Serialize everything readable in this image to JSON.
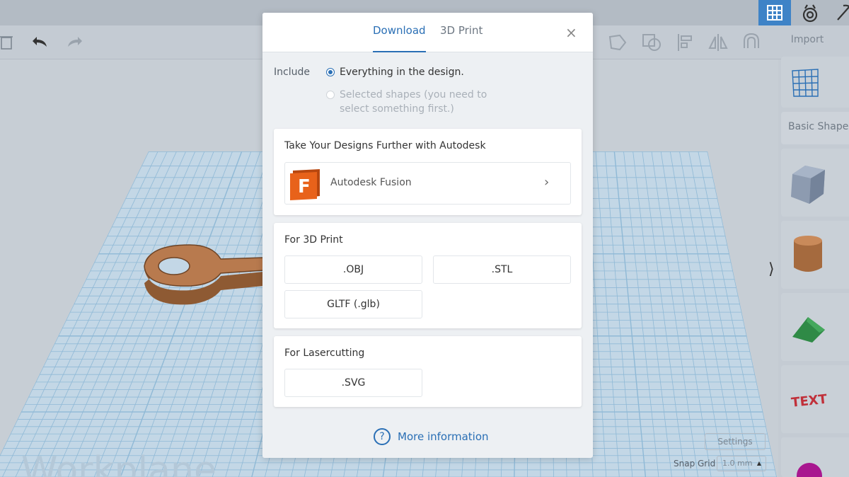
{
  "toolbar": {
    "undo_icon": "undo-arrow-icon",
    "redo_icon": "redo-arrow-icon"
  },
  "sidebar": {
    "import_label": "Import",
    "basic_shapes_label": "Basic Shapes",
    "settings_label": "Settings",
    "snap_grid_label": "Snap Grid",
    "snap_grid_value": "1.0 mm"
  },
  "workplane": {
    "label": "Workplane"
  },
  "modal": {
    "tabs": [
      {
        "label": "Download",
        "active": true
      },
      {
        "label": "3D Print",
        "active": false
      }
    ],
    "close_symbol": "×",
    "include_label": "Include",
    "options": [
      {
        "label": "Everything in the design.",
        "checked": true,
        "disabled": false
      },
      {
        "label": "Selected shapes (you need to select something first.)",
        "checked": false,
        "disabled": true
      }
    ],
    "autodesk_section": {
      "title": "Take Your Designs Further with Autodesk",
      "fusion_label": "Autodesk Fusion",
      "fusion_logo_letter": "F"
    },
    "print_section": {
      "title": "For 3D Print",
      "buttons": [
        ".OBJ",
        ".STL",
        "GLTF (.glb)"
      ]
    },
    "laser_section": {
      "title": "For Lasercutting",
      "buttons": [
        ".SVG"
      ]
    },
    "more_info": {
      "icon_glyph": "?",
      "label": "More information"
    }
  },
  "colors": {
    "accent": "#2a6fb5",
    "fusion_orange": "#e8621a",
    "grid_blue": "#8fb9d6",
    "shape_brown": "#b87a4e"
  }
}
